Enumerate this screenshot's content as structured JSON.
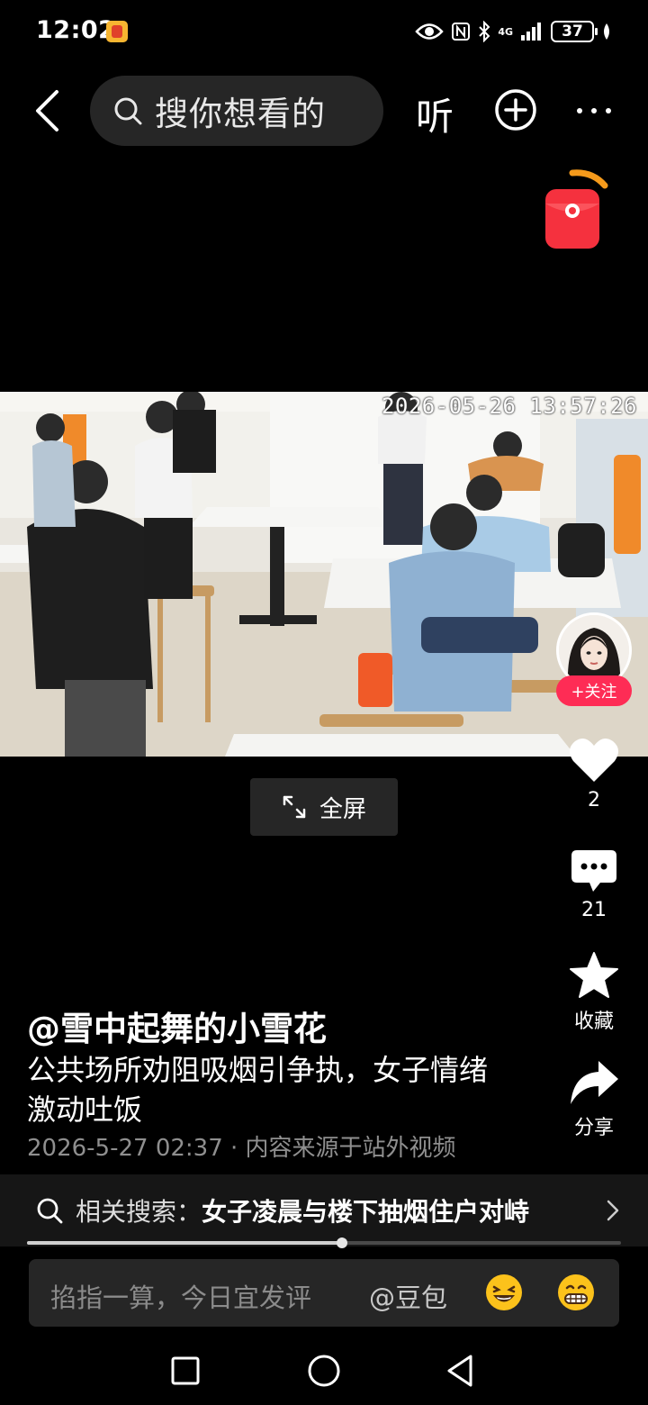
{
  "status_bar": {
    "time": "12:02",
    "network": "4G",
    "battery": "37"
  },
  "top_nav": {
    "search_placeholder": "搜你想看的",
    "listen_label": "听"
  },
  "video": {
    "timestamp_overlay": "2026-05-26 13:57:26",
    "fullscreen_label": "全屏"
  },
  "side_actions": {
    "follow_label": "+关注",
    "like_count": "2",
    "comment_count": "21",
    "favorite_label": "收藏",
    "share_label": "分享"
  },
  "post": {
    "author": "@雪中起舞的小雪花",
    "description": "公共场所劝阻吸烟引争执，女子情绪激动吐饭",
    "meta": "2026-5-27 02:37 · 内容来源于站外视频"
  },
  "related_search": {
    "prefix": "相关搜索：",
    "query": "女子凌晨与楼下抽烟住户对峙"
  },
  "playback": {
    "progress_fraction": 0.53
  },
  "comment_bar": {
    "placeholder": "掐指一算，今日宜发评",
    "mention": "@豆包"
  },
  "colors": {
    "accent_red": "#fe2c55",
    "background": "#000000"
  }
}
